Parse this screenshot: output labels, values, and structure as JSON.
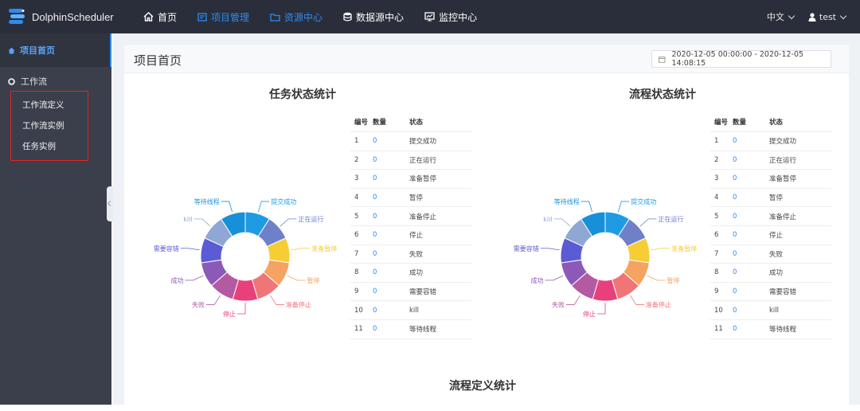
{
  "header": {
    "app_name": "DolphinScheduler",
    "nav": [
      {
        "label": "首页",
        "icon": "home-icon",
        "active": false
      },
      {
        "label": "项目管理",
        "icon": "project-icon",
        "active": true
      },
      {
        "label": "资源中心",
        "icon": "folder-icon",
        "active": true
      },
      {
        "label": "数据源中心",
        "icon": "database-icon",
        "active": false
      },
      {
        "label": "监控中心",
        "icon": "monitor-icon",
        "active": false
      }
    ],
    "language": "中文",
    "user": "test"
  },
  "sidebar": {
    "home_label": "项目首页",
    "group_label": "工作流",
    "items": [
      "工作流定义",
      "工作流实例",
      "任务实例"
    ]
  },
  "page": {
    "title": "项目首页",
    "date_range": "2020-12-05 00:00:00 - 2020-12-05 14:08:15",
    "task_section_title": "任务状态统计",
    "process_section_title": "流程状态统计",
    "definition_section_title": "流程定义统计"
  },
  "table_headers": {
    "id": "编号",
    "count": "数量",
    "state": "状态"
  },
  "states": [
    {
      "id": "1",
      "count": "0",
      "label": "提交成功",
      "color": "#1f9be4"
    },
    {
      "id": "2",
      "count": "0",
      "label": "正在运行",
      "color": "#6e80c8"
    },
    {
      "id": "3",
      "count": "0",
      "label": "准备暂停",
      "color": "#f7cd35"
    },
    {
      "id": "4",
      "count": "0",
      "label": "暂停",
      "color": "#f4a362"
    },
    {
      "id": "5",
      "count": "0",
      "label": "准备停止",
      "color": "#f07577"
    },
    {
      "id": "6",
      "count": "0",
      "label": "停止",
      "color": "#e8407a"
    },
    {
      "id": "7",
      "count": "0",
      "label": "失败",
      "color": "#b35aa3"
    },
    {
      "id": "8",
      "count": "0",
      "label": "成功",
      "color": "#8d59b8"
    },
    {
      "id": "9",
      "count": "0",
      "label": "需要容错",
      "color": "#5b5bd6"
    },
    {
      "id": "10",
      "count": "0",
      "label": "kill",
      "color": "#8fa7d4"
    },
    {
      "id": "11",
      "count": "0",
      "label": "等待线程",
      "color": "#1790d9"
    }
  ],
  "chart_data": [
    {
      "type": "pie",
      "title": "任务状态统计",
      "categories": [
        "提交成功",
        "正在运行",
        "准备暂停",
        "暂停",
        "准备停止",
        "停止",
        "失败",
        "成功",
        "需要容错",
        "kill",
        "等待线程"
      ],
      "values": [
        0,
        0,
        0,
        0,
        0,
        0,
        0,
        0,
        0,
        0,
        0
      ]
    },
    {
      "type": "pie",
      "title": "流程状态统计",
      "categories": [
        "提交成功",
        "正在运行",
        "准备暂停",
        "暂停",
        "准备停止",
        "停止",
        "失败",
        "成功",
        "需要容错",
        "kill",
        "等待线程"
      ],
      "values": [
        0,
        0,
        0,
        0,
        0,
        0,
        0,
        0,
        0,
        0,
        0
      ]
    }
  ]
}
